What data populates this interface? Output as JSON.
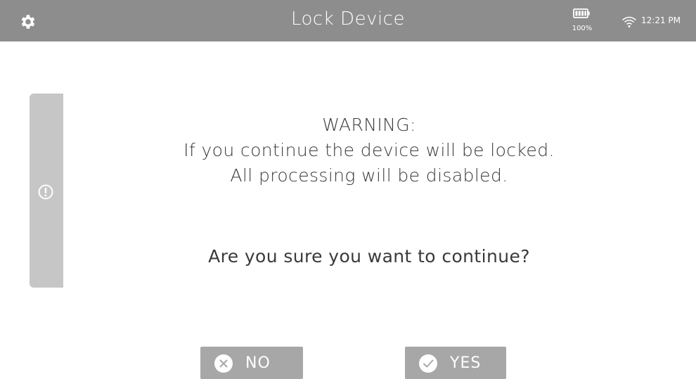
{
  "header": {
    "title": "Lock Device",
    "settings_icon": "gear-icon",
    "battery_icon": "battery-icon",
    "battery_level": "100%",
    "wifi_icon": "wifi-icon",
    "time": "12:21 PM",
    "bar_color": "#8d8d8d"
  },
  "side_tab": {
    "icon": "alert-circle-icon",
    "color": "#c6c6c6"
  },
  "dialog": {
    "warning_title": "WARNING:",
    "line1": "If you continue the device will be locked.",
    "line2": "All processing will be disabled.",
    "question": "Are you sure you want to continue?"
  },
  "buttons": {
    "no": {
      "label": "NO",
      "icon": "close-circle-icon"
    },
    "yes": {
      "label": "YES",
      "icon": "check-circle-icon"
    },
    "color": "#a7a7a7"
  }
}
